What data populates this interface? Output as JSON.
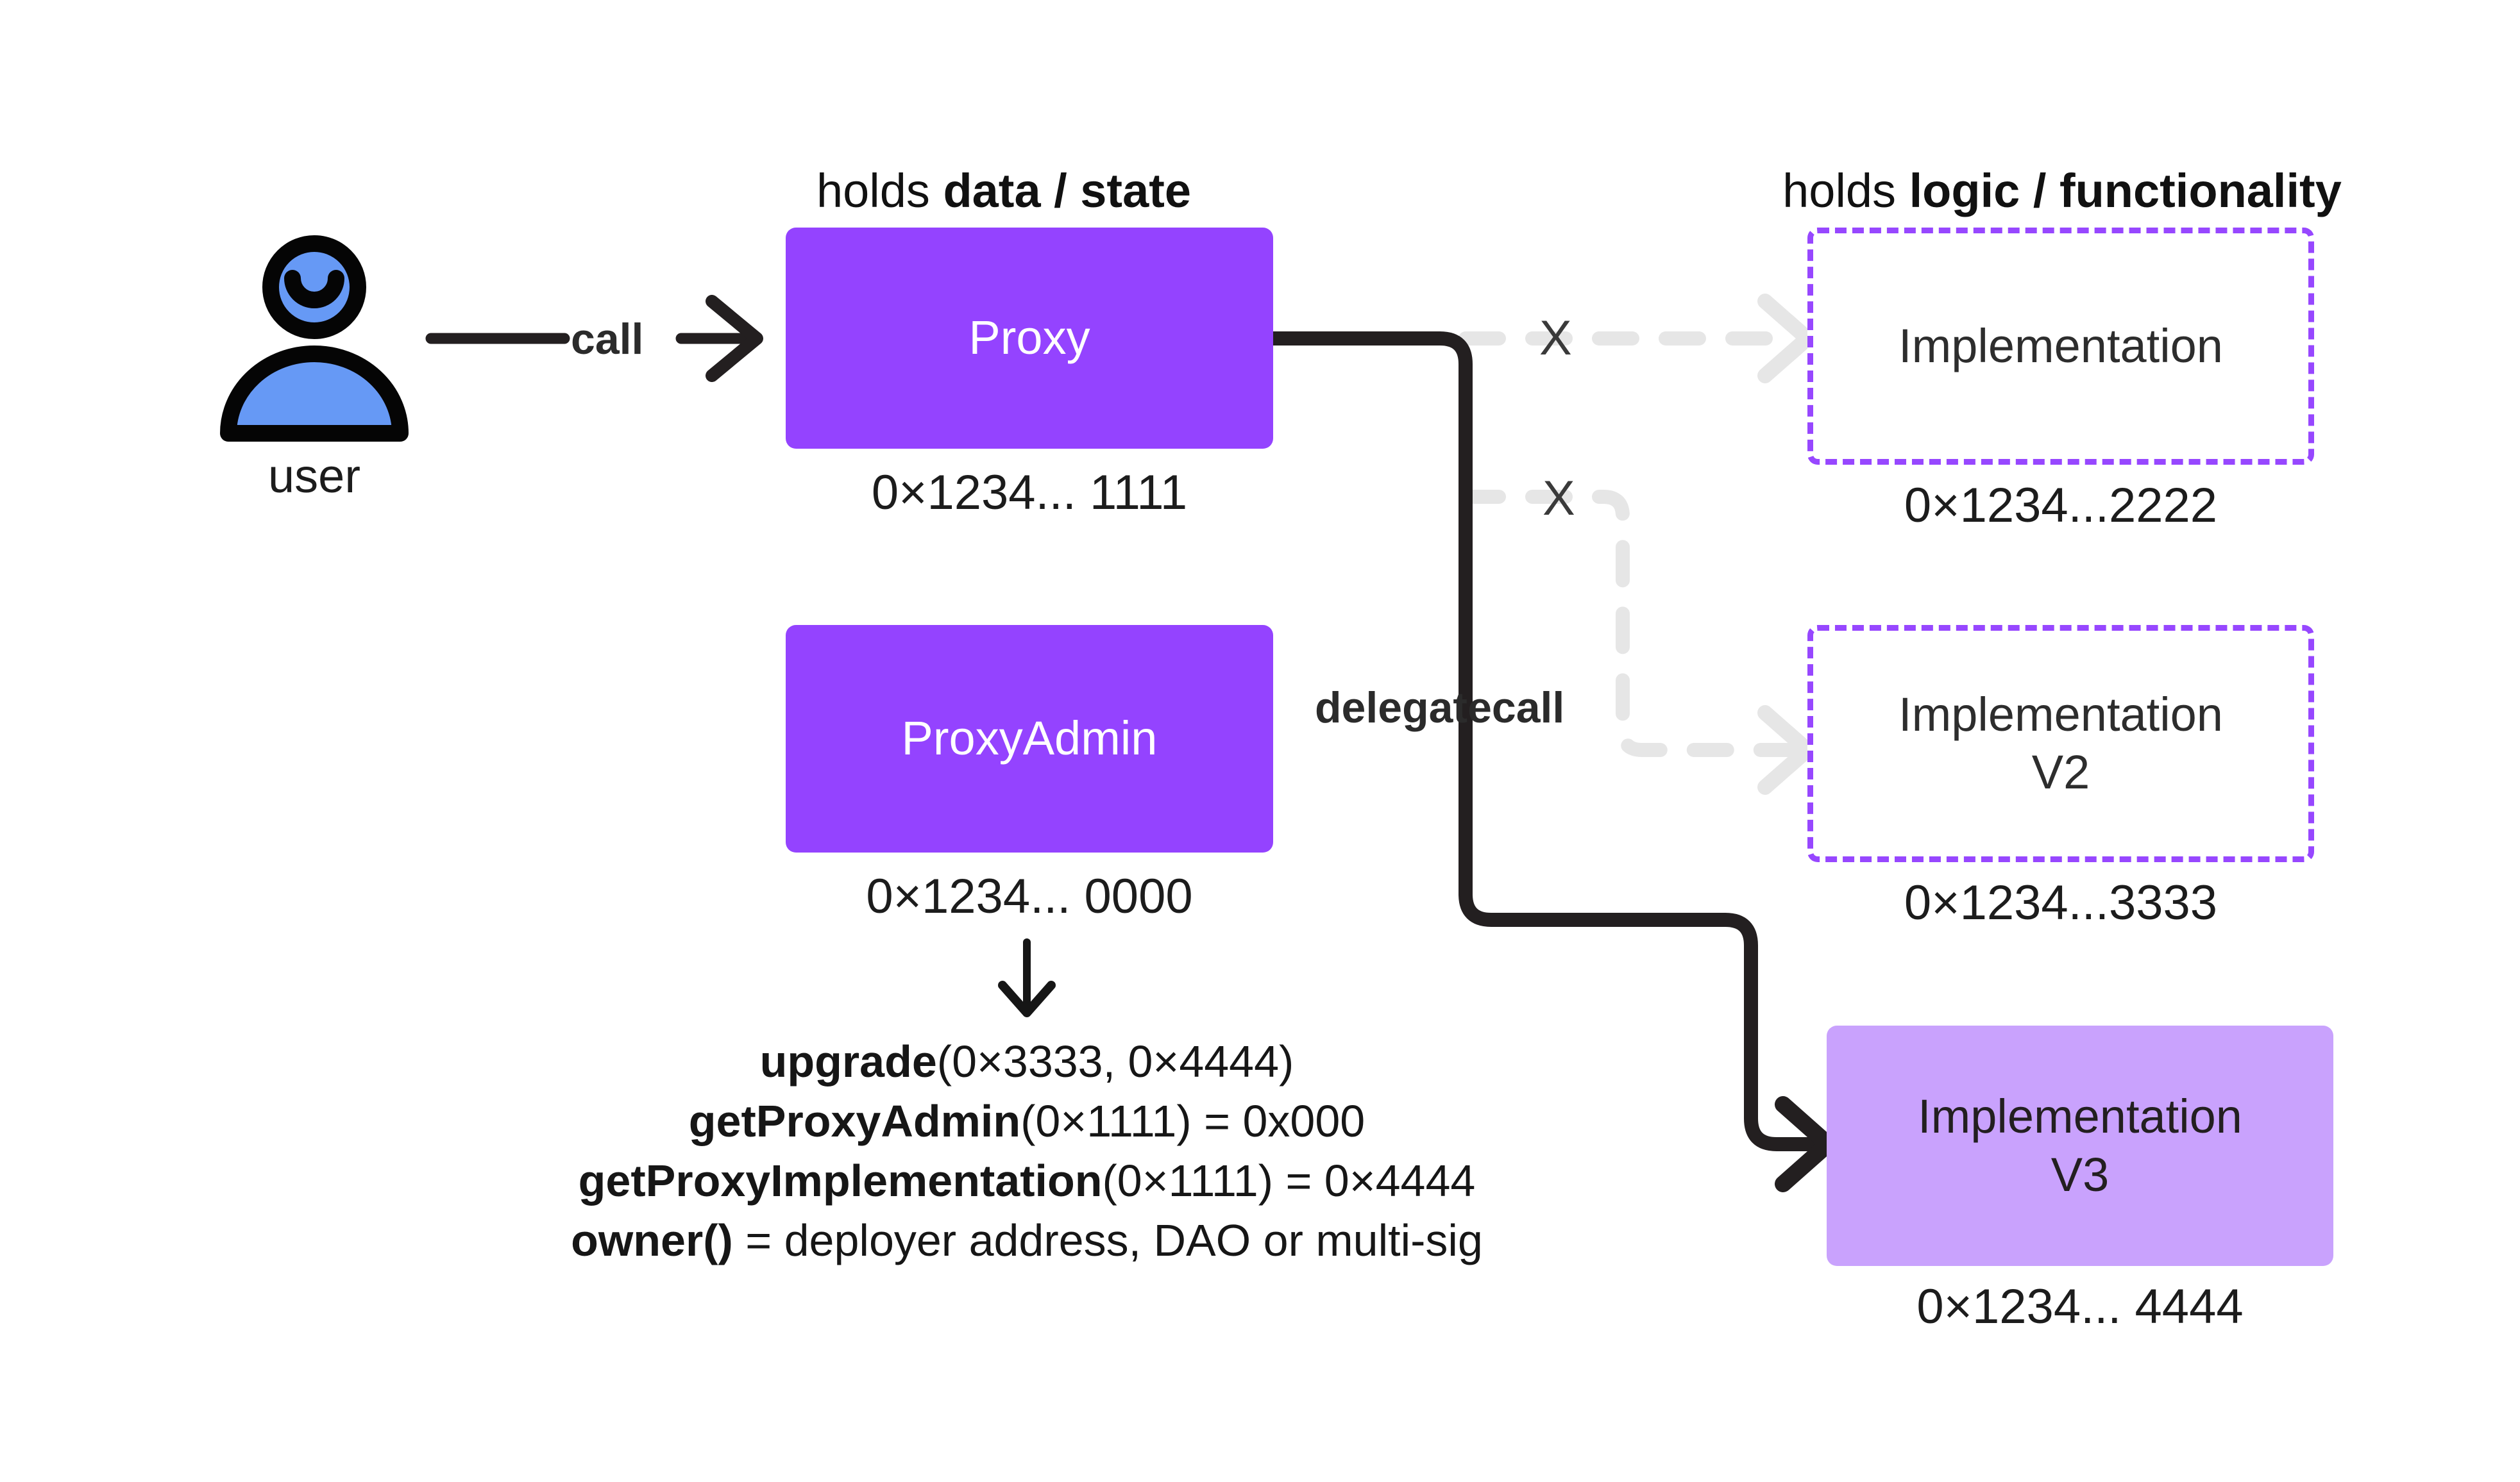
{
  "diagram": {
    "title_left": {
      "plain": "holds ",
      "bold": "data / state"
    },
    "title_right": {
      "plain": "holds ",
      "bold": "logic / functionality"
    }
  },
  "actor": {
    "label": "user",
    "icon": "user-avatar-icon",
    "color": "#6699f5"
  },
  "nodes": {
    "proxy": {
      "label": "Proxy",
      "address": "0×1234... 1111",
      "fill": "#9443ff",
      "text_color": "#ffffff"
    },
    "proxy_admin": {
      "label": "ProxyAdmin",
      "address": "0×1234... 0000",
      "fill": "#9443ff",
      "text_color": "#ffffff"
    },
    "implementation": {
      "label": "Implementation",
      "address": "0×1234...2222",
      "border": "#9747ff",
      "style": "dashed"
    },
    "implementation_v2": {
      "label_line1": "Implementation",
      "label_line2": "V2",
      "address": "0×1234...3333",
      "border": "#9747ff",
      "style": "dashed"
    },
    "implementation_v3": {
      "label_line1": "Implementation",
      "label_line2": "V3",
      "address": "0×1234... 4444",
      "fill": "#c9a2fd",
      "text_color": "#231f20",
      "style": "solid"
    }
  },
  "edges": {
    "call": {
      "label": "call",
      "color": "#231f20",
      "style": "solid"
    },
    "delegatecall": {
      "label": "delegatecall",
      "color": "#231f20",
      "style": "solid"
    },
    "inactive_1": {
      "marker": "X",
      "color": "#e6e6e6",
      "style": "dashed"
    },
    "inactive_2": {
      "marker": "X",
      "color": "#e6e6e6",
      "style": "dashed"
    },
    "admin_down": {
      "label": "",
      "color": "#161616",
      "style": "solid"
    }
  },
  "functions": [
    {
      "name": "upgrade",
      "rest": "(0×3333, 0×4444)"
    },
    {
      "name": "getProxyAdmin",
      "rest": "(0×1111) = 0x000"
    },
    {
      "name": "getProxyImplementation",
      "rest": "(0×1111) = 0×4444"
    },
    {
      "name": "owner()",
      "rest": " = deployer address, DAO or multi-sig"
    }
  ]
}
